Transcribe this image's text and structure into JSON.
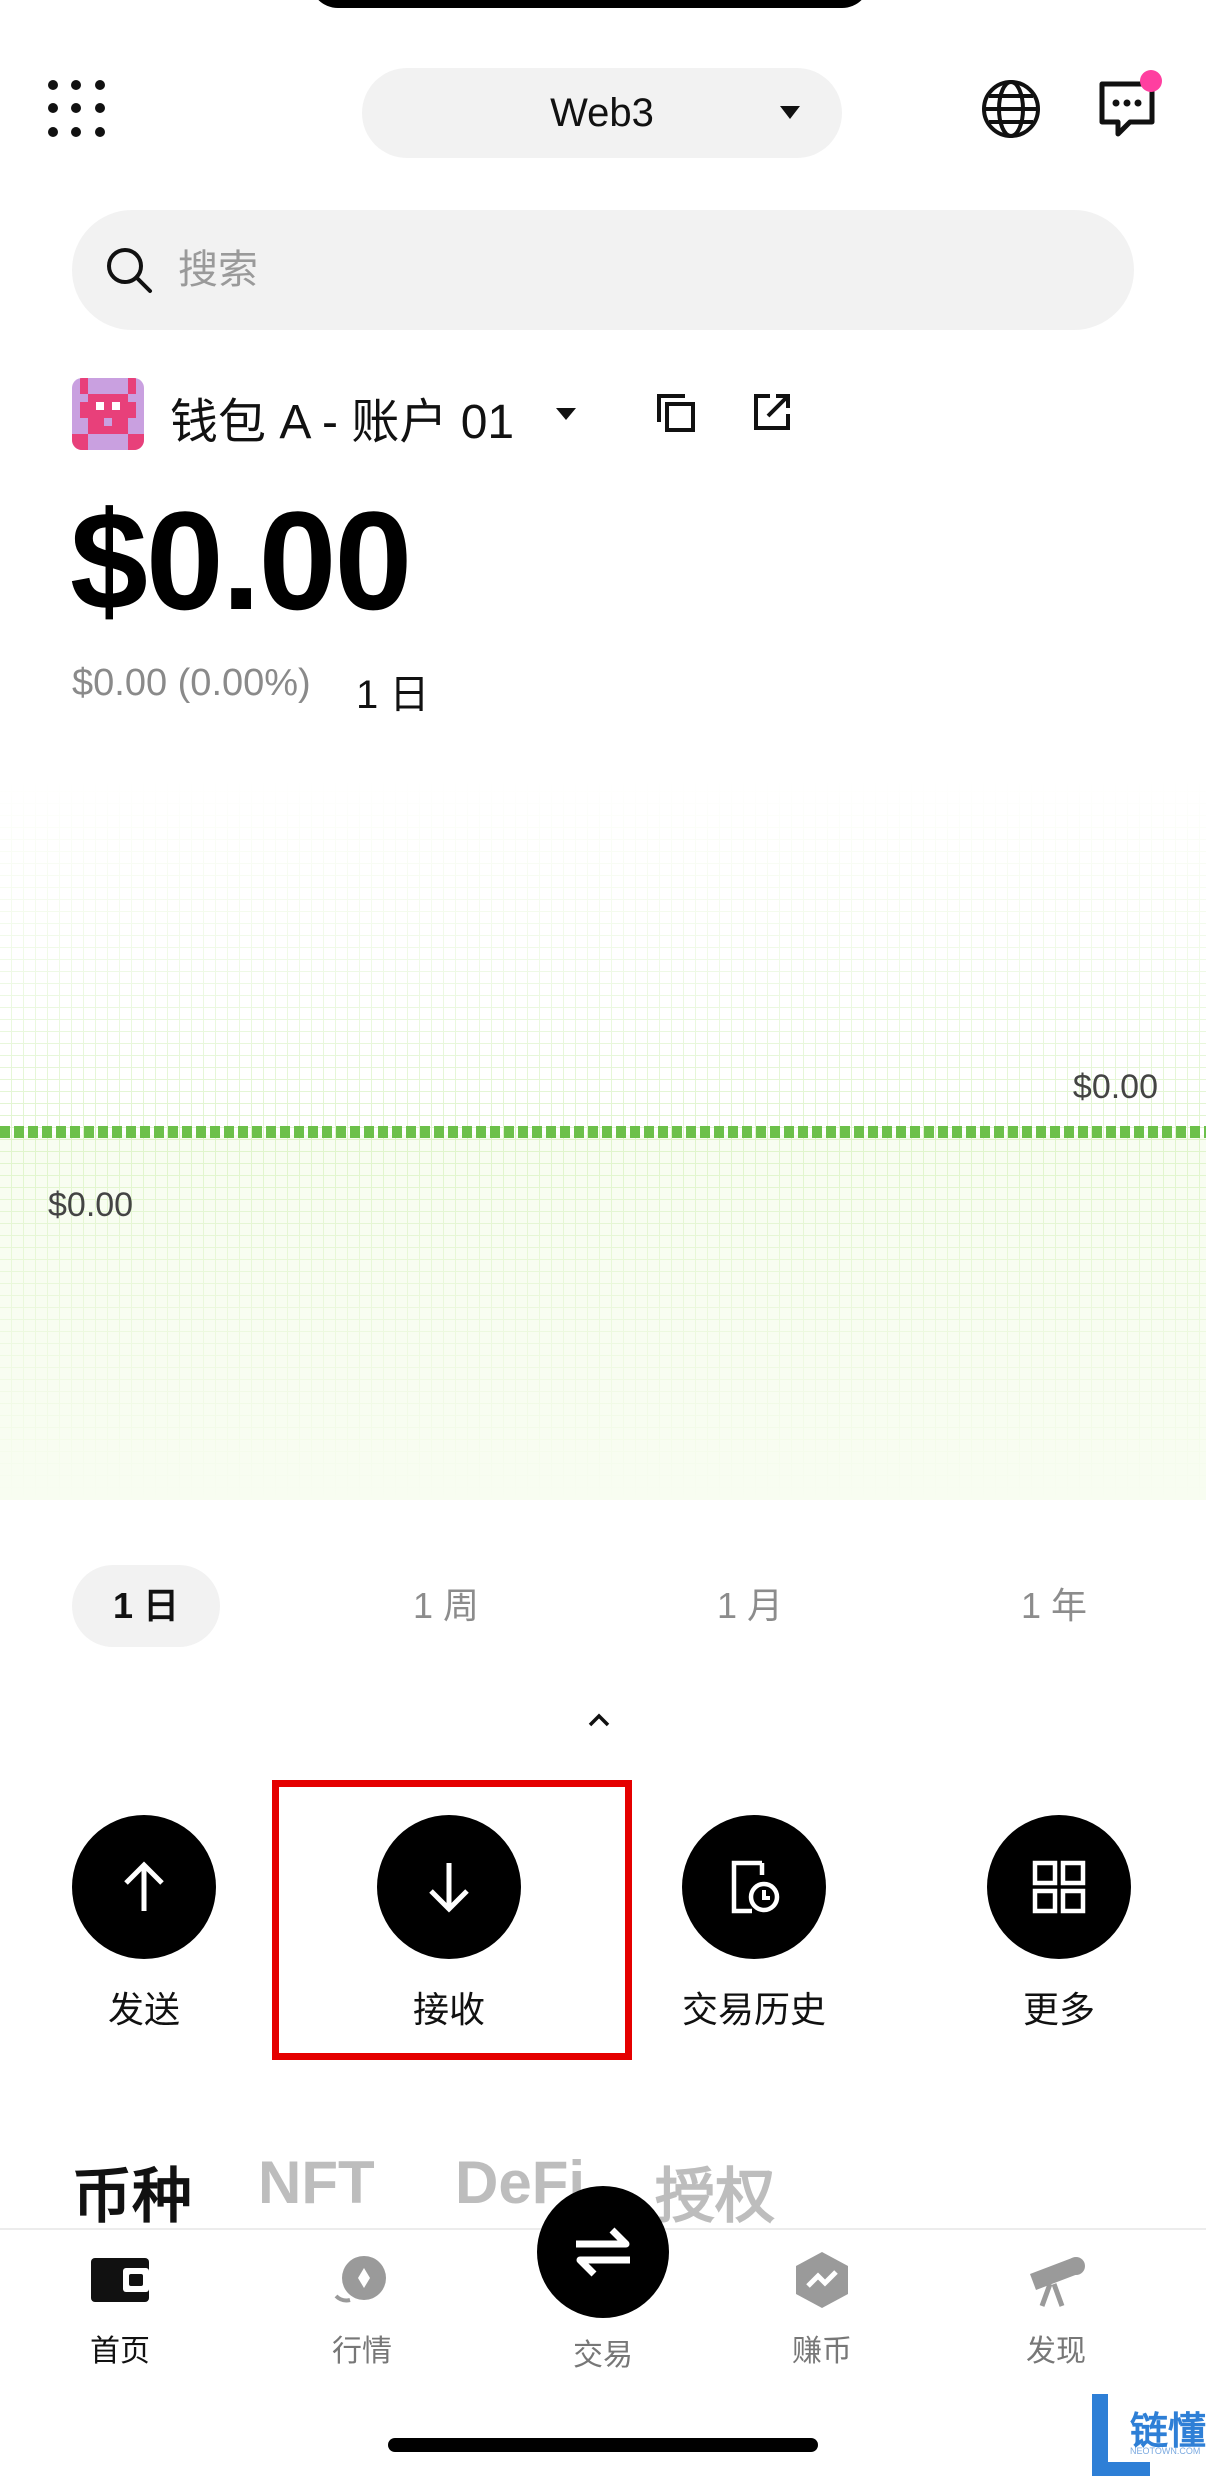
{
  "header": {
    "mode_label": "Web3",
    "has_unread_dot": true
  },
  "search": {
    "placeholder": "搜索"
  },
  "account": {
    "name": "钱包 A - 账户 01",
    "balance": "$0.00",
    "change": "$0.00 (0.00%)",
    "change_period": "1 日"
  },
  "chart_data": {
    "type": "line",
    "high_label": "$0.00",
    "low_label": "$0.00",
    "values": [
      0,
      0
    ],
    "line_color": "#6cc04a"
  },
  "periods": [
    "1 日",
    "1 周",
    "1 月",
    "1 年"
  ],
  "active_period_index": 0,
  "actions": [
    {
      "label": "发送",
      "icon": "arrow-up-icon"
    },
    {
      "label": "接收",
      "icon": "arrow-down-icon"
    },
    {
      "label": "交易历史",
      "icon": "history-icon"
    },
    {
      "label": "更多",
      "icon": "grid-icon"
    }
  ],
  "asset_tabs": [
    "币种",
    "NFT",
    "DeFi",
    "授权"
  ],
  "active_asset_tab_index": 0,
  "nav": {
    "home": "首页",
    "market": "行情",
    "trade": "交易",
    "earn": "赚币",
    "discover": "发现"
  },
  "watermark": {
    "text": "链懂",
    "sub": "NEOTOWN.COM"
  },
  "colors": {
    "highlight": "#e50000",
    "chart_line": "#6cc04a",
    "notification": "#ff3fa0"
  }
}
